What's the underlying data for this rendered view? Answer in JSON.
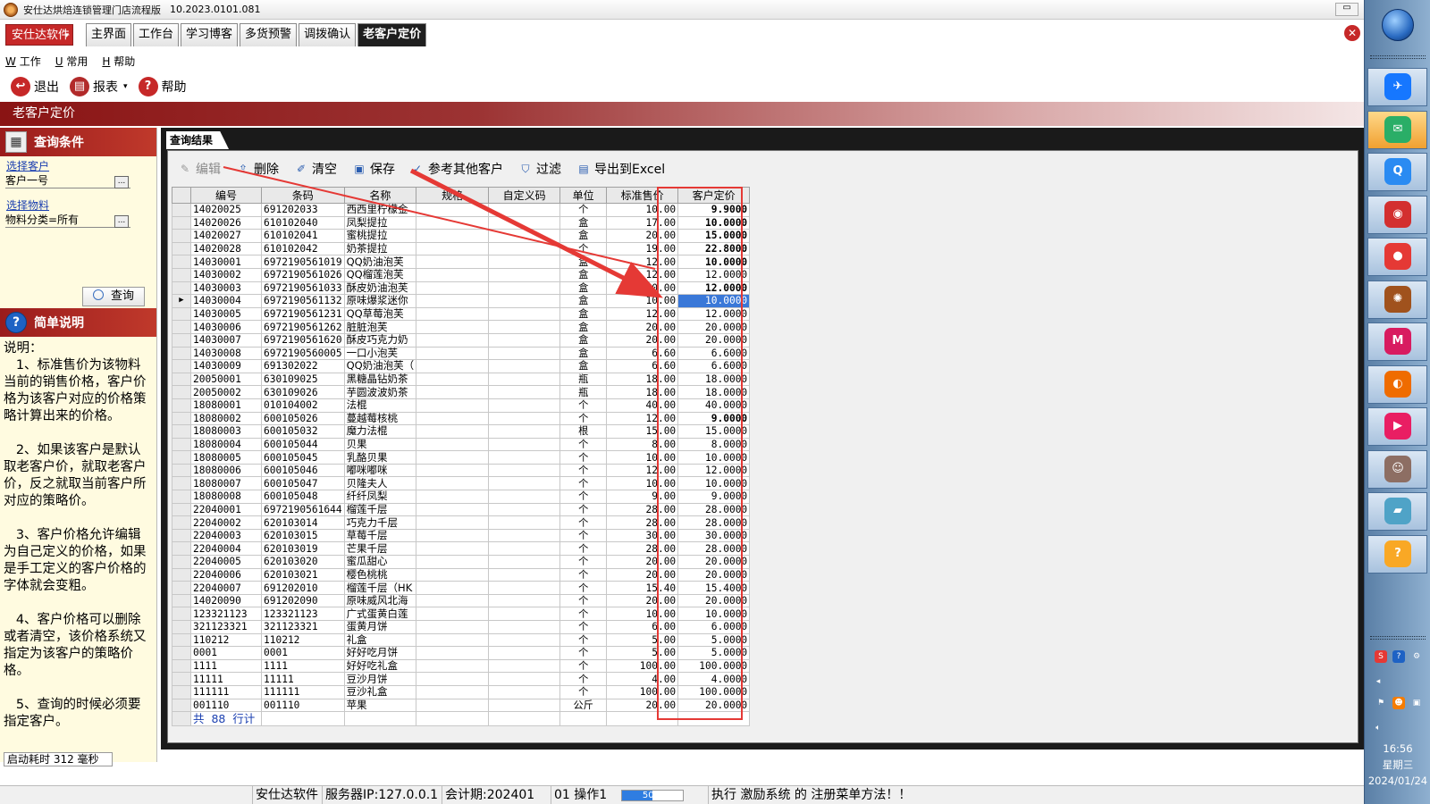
{
  "window": {
    "title": "安仕达烘焙连锁管理门店流程版",
    "version": "10.2023.0101.081",
    "minimize_label": "▭"
  },
  "brand_button": "安仕达软件",
  "module_tabs": [
    "主界面",
    "工作台",
    "学习博客",
    "多货预警",
    "调拨确认",
    "老客户定价"
  ],
  "active_tab": "老客户定价",
  "menu": [
    {
      "key": "W",
      "label": "工作"
    },
    {
      "key": "U",
      "label": "常用"
    },
    {
      "key": "H",
      "label": "帮助"
    }
  ],
  "toolbar": {
    "exit": "退出",
    "report": "报表",
    "help": "帮助"
  },
  "page_header": "老客户定价",
  "query_panel": {
    "title": "查询条件",
    "customer_link": "选择客户",
    "customer_value": "客户一号",
    "material_link": "选择物料",
    "material_value": "物料分类=所有",
    "query_button": "查询"
  },
  "notes": {
    "title": "简单说明",
    "text": "说明：\n   1、标准售价为该物料当前的销售价格，客户价格为该客户对应的价格策略计算出来的价格。\n\n   2、如果该客户是默认取老客户价，就取老客户价，反之就取当前客户所对应的策略价。\n\n   3、客户价格允许编辑为自己定义的价格，如果是手工定义的客户价格的字体就会变粗。\n\n   4、客户价格可以删除或者清空，该价格系统又指定为该客户的策略价格。\n\n   5、查询的时候必须要指定客户。"
  },
  "startup_time": "启动耗时 312 毫秒",
  "results": {
    "tab_label": "查询结果",
    "actions": {
      "edit": "编辑",
      "delete": "删除",
      "clear": "清空",
      "save": "保存",
      "reference": "参考其他客户",
      "filter": "过滤",
      "export": "导出到Excel"
    },
    "columns": {
      "code": "编号",
      "barcode": "条码",
      "name": "名称",
      "spec": "规格",
      "custom_code": "自定义码",
      "unit": "单位",
      "std_price": "标准售价",
      "cust_price": "客户定价"
    },
    "rows": [
      {
        "code": "14020025",
        "barcode": "691202033",
        "name": "西西里柠檬金",
        "unit": "个",
        "std_price": "10.00",
        "cust_price": "9.9000",
        "manual": true
      },
      {
        "code": "14020026",
        "barcode": "610102040",
        "name": "凤梨提拉",
        "unit": "盒",
        "std_price": "17.00",
        "cust_price": "10.0000",
        "manual": true
      },
      {
        "code": "14020027",
        "barcode": "610102041",
        "name": "蜜桃提拉",
        "unit": "盒",
        "std_price": "20.00",
        "cust_price": "15.0000",
        "manual": true
      },
      {
        "code": "14020028",
        "barcode": "610102042",
        "name": "奶茶提拉",
        "unit": "个",
        "std_price": "19.00",
        "cust_price": "22.8000",
        "manual": true
      },
      {
        "code": "14030001",
        "barcode": "6972190561019",
        "name": "QQ奶油泡芙",
        "unit": "盒",
        "std_price": "12.00",
        "cust_price": "10.0000",
        "manual": true
      },
      {
        "code": "14030002",
        "barcode": "6972190561026",
        "name": "QQ榴莲泡芙",
        "unit": "盒",
        "std_price": "12.00",
        "cust_price": "12.0000",
        "manual": false
      },
      {
        "code": "14030003",
        "barcode": "6972190561033",
        "name": "酥皮奶油泡芙",
        "unit": "盒",
        "std_price": "10.00",
        "cust_price": "12.0000",
        "manual": true
      },
      {
        "code": "14030004",
        "barcode": "6972190561132",
        "name": "原味爆浆迷你",
        "unit": "盒",
        "std_price": "10.00",
        "cust_price": "10.0000",
        "manual": false,
        "current": true
      },
      {
        "code": "14030005",
        "barcode": "6972190561231",
        "name": "QQ草莓泡芙",
        "unit": "盒",
        "std_price": "12.00",
        "cust_price": "12.0000",
        "manual": false
      },
      {
        "code": "14030006",
        "barcode": "6972190561262",
        "name": "脏脏泡芙",
        "unit": "盒",
        "std_price": "20.00",
        "cust_price": "20.0000",
        "manual": false
      },
      {
        "code": "14030007",
        "barcode": "6972190561620",
        "name": "酥皮巧克力奶",
        "unit": "盒",
        "std_price": "20.00",
        "cust_price": "20.0000",
        "manual": false
      },
      {
        "code": "14030008",
        "barcode": "6972190560005",
        "name": "一口小泡芙",
        "unit": "盒",
        "std_price": "6.60",
        "cust_price": "6.6000",
        "manual": false
      },
      {
        "code": "14030009",
        "barcode": "691302022",
        "name": "QQ奶油泡芙（",
        "unit": "盒",
        "std_price": "6.60",
        "cust_price": "6.6000",
        "manual": false
      },
      {
        "code": "20050001",
        "barcode": "630109025",
        "name": "黑糖晶钻奶茶",
        "unit": "瓶",
        "std_price": "18.00",
        "cust_price": "18.0000",
        "manual": false
      },
      {
        "code": "20050002",
        "barcode": "630109026",
        "name": "芋圆波波奶茶",
        "unit": "瓶",
        "std_price": "18.00",
        "cust_price": "18.0000",
        "manual": false
      },
      {
        "code": "18080001",
        "barcode": "010104002",
        "name": "法棍",
        "unit": "个",
        "std_price": "40.00",
        "cust_price": "40.0000",
        "manual": false
      },
      {
        "code": "18080002",
        "barcode": "600105026",
        "name": "蔓越莓核桃",
        "unit": "个",
        "std_price": "12.00",
        "cust_price": "9.0000",
        "manual": true
      },
      {
        "code": "18080003",
        "barcode": "600105032",
        "name": "魔力法棍",
        "unit": "根",
        "std_price": "15.00",
        "cust_price": "15.0000",
        "manual": false
      },
      {
        "code": "18080004",
        "barcode": "600105044",
        "name": "贝果",
        "unit": "个",
        "std_price": "8.00",
        "cust_price": "8.0000",
        "manual": false
      },
      {
        "code": "18080005",
        "barcode": "600105045",
        "name": "乳酪贝果",
        "unit": "个",
        "std_price": "10.00",
        "cust_price": "10.0000",
        "manual": false
      },
      {
        "code": "18080006",
        "barcode": "600105046",
        "name": "嘟咪嘟咪",
        "unit": "个",
        "std_price": "12.00",
        "cust_price": "12.0000",
        "manual": false
      },
      {
        "code": "18080007",
        "barcode": "600105047",
        "name": "贝隆夫人",
        "unit": "个",
        "std_price": "10.00",
        "cust_price": "10.0000",
        "manual": false
      },
      {
        "code": "18080008",
        "barcode": "600105048",
        "name": "纤纤凤梨",
        "unit": "个",
        "std_price": "9.00",
        "cust_price": "9.0000",
        "manual": false
      },
      {
        "code": "22040001",
        "barcode": "6972190561644",
        "name": "榴莲千层",
        "unit": "个",
        "std_price": "28.00",
        "cust_price": "28.0000",
        "manual": false
      },
      {
        "code": "22040002",
        "barcode": "620103014",
        "name": "巧克力千层",
        "unit": "个",
        "std_price": "28.00",
        "cust_price": "28.0000",
        "manual": false
      },
      {
        "code": "22040003",
        "barcode": "620103015",
        "name": "草莓千层",
        "unit": "个",
        "std_price": "30.00",
        "cust_price": "30.0000",
        "manual": false
      },
      {
        "code": "22040004",
        "barcode": "620103019",
        "name": "芒果千层",
        "unit": "个",
        "std_price": "28.00",
        "cust_price": "28.0000",
        "manual": false
      },
      {
        "code": "22040005",
        "barcode": "620103020",
        "name": "蜜瓜甜心",
        "unit": "个",
        "std_price": "20.00",
        "cust_price": "20.0000",
        "manual": false
      },
      {
        "code": "22040006",
        "barcode": "620103021",
        "name": "樱色桃桃",
        "unit": "个",
        "std_price": "20.00",
        "cust_price": "20.0000",
        "manual": false
      },
      {
        "code": "22040007",
        "barcode": "691202010",
        "name": "榴莲千层（HK",
        "unit": "个",
        "std_price": "15.40",
        "cust_price": "15.4000",
        "manual": false
      },
      {
        "code": "14020090",
        "barcode": "691202090",
        "name": "原味威风北海",
        "unit": "个",
        "std_price": "20.00",
        "cust_price": "20.0000",
        "manual": false
      },
      {
        "code": "123321123",
        "barcode": "123321123",
        "name": "广式蛋黄白莲",
        "unit": "个",
        "std_price": "10.00",
        "cust_price": "10.0000",
        "manual": false
      },
      {
        "code": "321123321",
        "barcode": "321123321",
        "name": "蛋黄月饼",
        "unit": "个",
        "std_price": "6.00",
        "cust_price": "6.0000",
        "manual": false
      },
      {
        "code": "110212",
        "barcode": "110212",
        "name": "礼盒",
        "unit": "个",
        "std_price": "5.00",
        "cust_price": "5.0000",
        "manual": false
      },
      {
        "code": "0001",
        "barcode": "0001",
        "name": "好好吃月饼",
        "unit": "个",
        "std_price": "5.00",
        "cust_price": "5.0000",
        "manual": false
      },
      {
        "code": "1111",
        "barcode": "1111",
        "name": "好好吃礼盒",
        "unit": "个",
        "std_price": "100.00",
        "cust_price": "100.0000",
        "manual": false
      },
      {
        "code": "11111",
        "barcode": "11111",
        "name": "豆沙月饼",
        "unit": "个",
        "std_price": "4.00",
        "cust_price": "4.0000",
        "manual": false
      },
      {
        "code": "111111",
        "barcode": "111111",
        "name": "豆沙礼盒",
        "unit": "个",
        "std_price": "100.00",
        "cust_price": "100.0000",
        "manual": false
      },
      {
        "code": "001110",
        "barcode": "001110",
        "name": "苹果",
        "unit": "公斤",
        "std_price": "20.00",
        "cust_price": "20.0000",
        "manual": false
      }
    ],
    "footer": "共  88  行计"
  },
  "status_bar": {
    "company": "安仕达软件",
    "server": "服务器IP:127.0.0.1",
    "period": "会计期:202401",
    "operator": "01 操作1",
    "progress_label": "50%",
    "progress_value": 0.5,
    "message": "执行 激励系统 的 注册菜单方法！！"
  },
  "taskbar": {
    "apps": [
      {
        "name": "feishu-icon",
        "color": "#1677ff",
        "glyph": "✈"
      },
      {
        "name": "wechat-icon",
        "color": "#2aae67",
        "glyph": "✉",
        "active": true
      },
      {
        "name": "qq-browser-icon",
        "color": "#2a8bf2",
        "glyph": "Q"
      },
      {
        "name": "navigator-icon",
        "color": "#d32f2f",
        "glyph": "◉"
      },
      {
        "name": "fruit-app-icon",
        "color": "#e53935",
        "glyph": "●"
      },
      {
        "name": "bakery-app-icon",
        "color": "#a0521d",
        "glyph": "✺"
      },
      {
        "name": "maxthon-icon",
        "color": "#d81b60",
        "glyph": "M"
      },
      {
        "name": "firefox-icon",
        "color": "#ef6c00",
        "glyph": "◐"
      },
      {
        "name": "video-app-icon",
        "color": "#e91e63",
        "glyph": "▶"
      },
      {
        "name": "avatar-app-icon",
        "color": "#8d6e63",
        "glyph": "☺"
      },
      {
        "name": "eraser-app-icon",
        "color": "#4fa3c7",
        "glyph": "▰"
      },
      {
        "name": "help-app-icon",
        "color": "#f9a825",
        "glyph": "?"
      }
    ],
    "time": "16:56",
    "weekday": "星期三",
    "date": "2024/01/24"
  },
  "colors": {
    "brand_red": "#c62828",
    "highlight_box": "#e53935",
    "selected_cell": "#3a78d8",
    "link_blue": "#1a3fb0"
  }
}
